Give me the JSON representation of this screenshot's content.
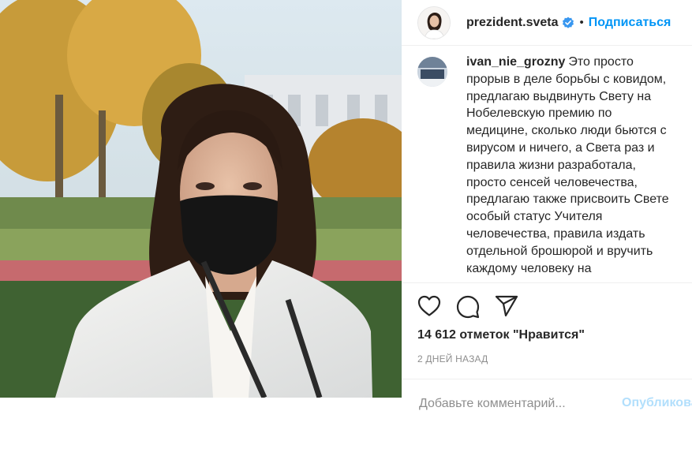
{
  "post": {
    "username": "prezident.sveta",
    "verified_icon": "verified-badge-icon",
    "separator": "•",
    "follow_label": "Подписаться",
    "photo_description_icon": "post-photo"
  },
  "comment": {
    "username": "ivan_nie_grozny",
    "text": "Это просто прорыв в деле борьбы с ковидом, предлагаю выдвинуть Свету на Нобелевскую премию по медицине, сколько люди бьются с вирусом и ничего, а Света раз и правила жизни разработала, просто сенсей человечества, предлагаю также присвоить Свете особый статус Учителя человечества, правила издать отдельной брошюрой и вручить каждому человеку на"
  },
  "actions": {
    "icons": [
      "heart-icon",
      "comment-icon",
      "share-icon"
    ]
  },
  "likes": "14 612 отметок \"Нравится\"",
  "timestamp": "2 ДНЕЙ НАЗАД",
  "add_comment": {
    "placeholder": "Добавьте комментарий...",
    "publish_label": "Опубликовать"
  },
  "colors": {
    "accent": "#0095f6",
    "publish_disabled": "#b2dffc",
    "muted": "#8e8e8e",
    "text": "#262626"
  }
}
